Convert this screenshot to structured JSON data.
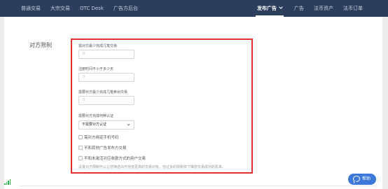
{
  "nav": {
    "left_items": [
      "普通交易",
      "大宗交易",
      "OTC Desk",
      "广告方后台"
    ],
    "active_item": "发布广告",
    "right_items": [
      "广告",
      "法币资产",
      "法币订单"
    ]
  },
  "section": {
    "title": "对方限制"
  },
  "form": {
    "min_trades_label": "需对方最少完成几笔交易",
    "min_trades_value": "0",
    "registered_days_label": "注册时间不小于多少天",
    "registered_days_value": "0",
    "min_sells_label": "需要对方最少完成几笔卖出交易",
    "min_sells_value": "0",
    "kyc_label": "需要对方完成何种认证",
    "kyc_value": "不需要对方认证",
    "checkboxes": [
      {
        "label": "需对方绑定手机号码",
        "checked": false
      },
      {
        "label": "不和其他广告发布方交易",
        "checked": false
      },
      {
        "label": "不和未激活对应收款方式的用户交易",
        "checked": false
      }
    ],
    "note": "设置对方限制可以让您筛选出可信度更高的交易对象，但过多的限制将下降您交易成功的机率。"
  },
  "help": {
    "label": "帮助"
  },
  "colors": {
    "nav_bg": "#2b3e5c",
    "highlight_border": "#e03132",
    "help_bg": "#3b78d8",
    "signal": "#2eaf4e"
  }
}
